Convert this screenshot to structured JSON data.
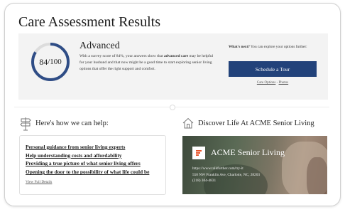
{
  "page": {
    "title": "Care Assessment Results"
  },
  "score": {
    "value": "84",
    "max": "/100",
    "fraction": 0.84,
    "ring_color": "#2f4d86",
    "ring_track_color": "#dcdcdc"
  },
  "result": {
    "level": "Advanced",
    "summary_before": "With a survey score of 84%, your answers show that ",
    "summary_bold": "advanced care",
    "summary_after": " may be helpful for your husband and that now might be a good time to start exploring senior living options that offer the right support and comfort."
  },
  "next_steps": {
    "label": "What's next?",
    "text": " You can explore your options further:",
    "button_label": "Schedule a Tour",
    "button_color": "#22427a",
    "link_care_options": "Care Options",
    "link_separator": " - ",
    "link_photos": "Photos"
  },
  "help": {
    "heading": "Here's how we can help:",
    "icon": "signpost-icon",
    "items": [
      "Personal guidance from senior living experts",
      "Help understanding costs and affordability",
      "Providing a true picture of what senior living offers",
      "Opening the door to the possibility of what life could be"
    ],
    "view_details": "View Full Details"
  },
  "discover": {
    "heading": "Discover Life At ACME Senior Living",
    "icon": "home-icon",
    "org_name": "ACME Senior Living",
    "url": "https://www.talkfurther.com/try-it",
    "address": "550 NW Franklin Ave, Charlotte, NC, 28203",
    "phone": "(218) 304-4831",
    "logo_color": "#e8542a"
  }
}
